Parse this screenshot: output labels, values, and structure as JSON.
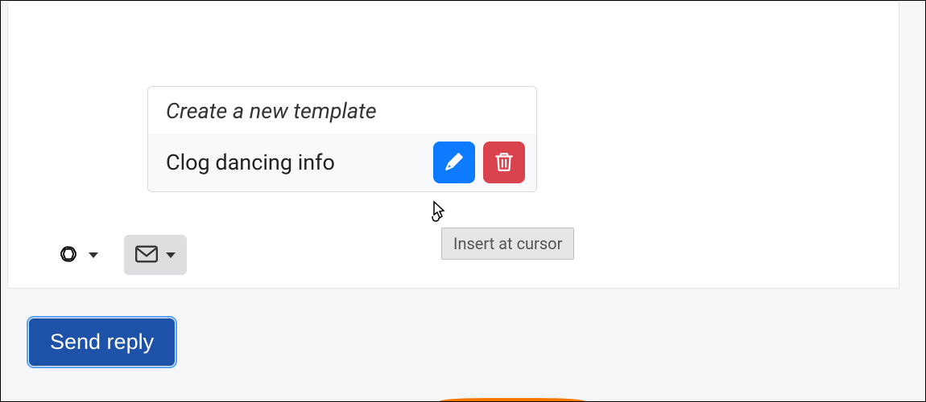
{
  "popup": {
    "header": "Create a new template",
    "template_name": "Clog dancing info"
  },
  "tooltip": {
    "text": "Insert at cursor"
  },
  "buttons": {
    "send": "Send reply"
  }
}
